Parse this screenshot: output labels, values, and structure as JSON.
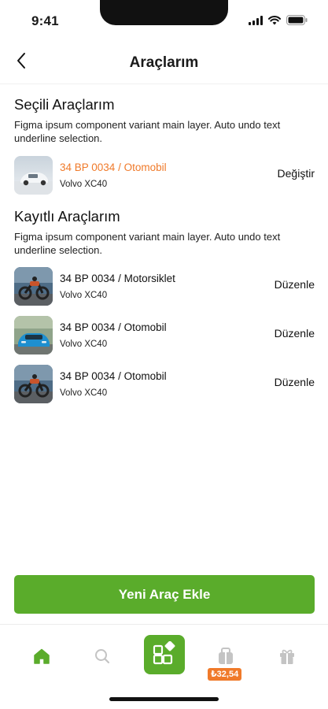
{
  "status_bar": {
    "time": "9:41"
  },
  "header": {
    "title": "Araçlarım"
  },
  "selected_section": {
    "title": "Seçili Araçlarım",
    "description": "Figma ipsum component variant main layer. Auto undo text underline selection.",
    "vehicle": {
      "plate": "34 BP 0034 / Otomobil",
      "model": "Volvo XC40",
      "action": "Değiştir"
    }
  },
  "saved_section": {
    "title": "Kayıtlı Araçlarım",
    "description": "Figma ipsum component variant main layer. Auto undo text underline selection.",
    "vehicles": [
      {
        "plate": "34 BP 0034 / Motorsiklet",
        "model": "Volvo XC40",
        "action": "Düzenle"
      },
      {
        "plate": "34 BP 0034 / Otomobil",
        "model": "Volvo XC40",
        "action": "Düzenle"
      },
      {
        "plate": "34 BP 0034 / Otomobil",
        "model": "Volvo XC40",
        "action": "Düzenle"
      }
    ]
  },
  "cta": {
    "label": "Yeni Araç Ekle"
  },
  "bottom_nav": {
    "wallet_badge": "₺32,54",
    "active_color": "#5aac2b",
    "inactive_color": "#c4c4c4",
    "badge_color": "#f07a2a"
  }
}
